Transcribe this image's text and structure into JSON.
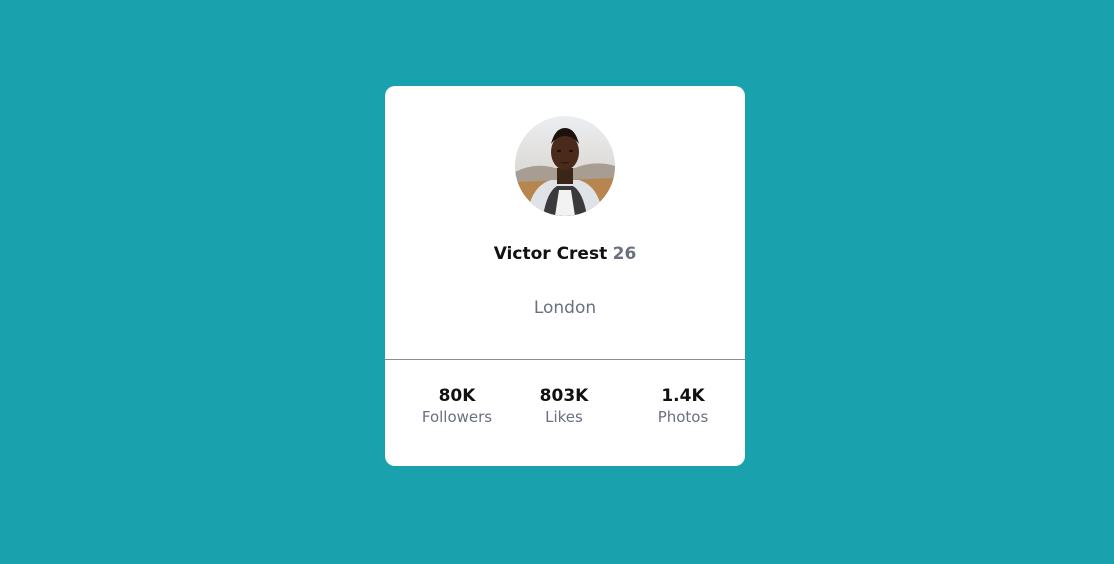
{
  "profile": {
    "name": "Victor Crest",
    "age": "26",
    "location": "London"
  },
  "stats": [
    {
      "value": "80K",
      "label": "Followers"
    },
    {
      "value": "803K",
      "label": "Likes"
    },
    {
      "value": "1.4K",
      "label": "Photos"
    }
  ],
  "colors": {
    "background": "#19a2ae",
    "card": "#ffffff",
    "primary_text": "#111111",
    "secondary_text": "#6b7080"
  }
}
